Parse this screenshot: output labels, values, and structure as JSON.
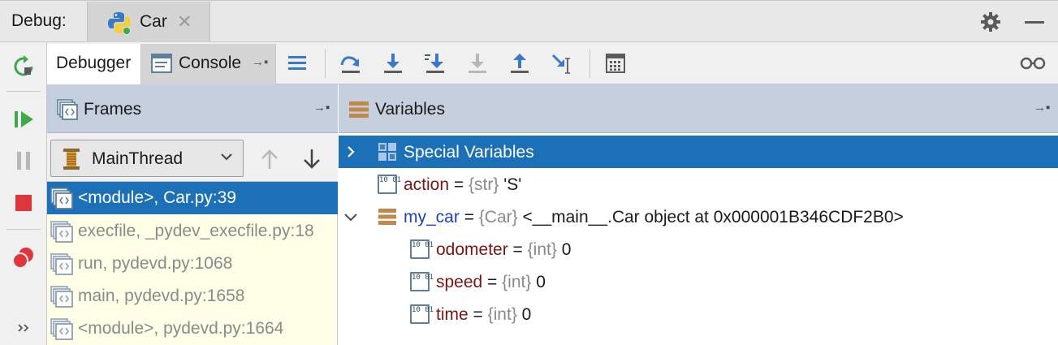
{
  "titlebar": {
    "label": "Debug:",
    "run_tab": "Car",
    "close_glyph": "✕"
  },
  "toolbar": {
    "tabs": {
      "debugger": "Debugger",
      "console": "Console"
    },
    "pin_glyph": "→▪",
    "icons": [
      "rerun-icon",
      "resume-icon",
      "pause-icon",
      "stop-icon",
      "view-breakpoints-icon",
      "more-icon"
    ],
    "step_icons": [
      "show-execution-point-icon",
      "step-over-icon",
      "step-into-icon",
      "step-into-my-code-icon",
      "force-step-into-icon",
      "step-out-icon",
      "run-to-cursor-icon",
      "evaluate-expression-icon",
      "watches-icon"
    ]
  },
  "frames": {
    "title": "Frames",
    "thread": "MainThread",
    "items": [
      {
        "label": "<module>, Car.py:39",
        "selected": true
      },
      {
        "label": "execfile, _pydev_execfile.py:18",
        "selected": false
      },
      {
        "label": "run, pydevd.py:1068",
        "selected": false
      },
      {
        "label": "main, pydevd.py:1658",
        "selected": false
      },
      {
        "label": "<module>, pydevd.py:1664",
        "selected": false
      }
    ]
  },
  "variables": {
    "title": "Variables",
    "rows": [
      {
        "name": "Special Variables",
        "eq": "",
        "type": "",
        "value": ""
      },
      {
        "name": "action",
        "eq": " = ",
        "type": "{str} ",
        "value": "'S'"
      },
      {
        "name": "my_car",
        "eq": " = ",
        "type": "{Car} ",
        "value": "<__main__.Car object at 0x000001B346CDF2B0>"
      },
      {
        "name": "odometer",
        "eq": " = ",
        "type": "{int} ",
        "value": "0"
      },
      {
        "name": "speed",
        "eq": " = ",
        "type": "{int} ",
        "value": "0"
      },
      {
        "name": "time",
        "eq": " = ",
        "type": "{int} ",
        "value": "0"
      }
    ],
    "num_icon_text": "10 01"
  },
  "colors": {
    "accent": "#1c70b8",
    "header": "#c5cfdd",
    "frames_bg": "#fffee6",
    "var_name": "#7a1414"
  }
}
